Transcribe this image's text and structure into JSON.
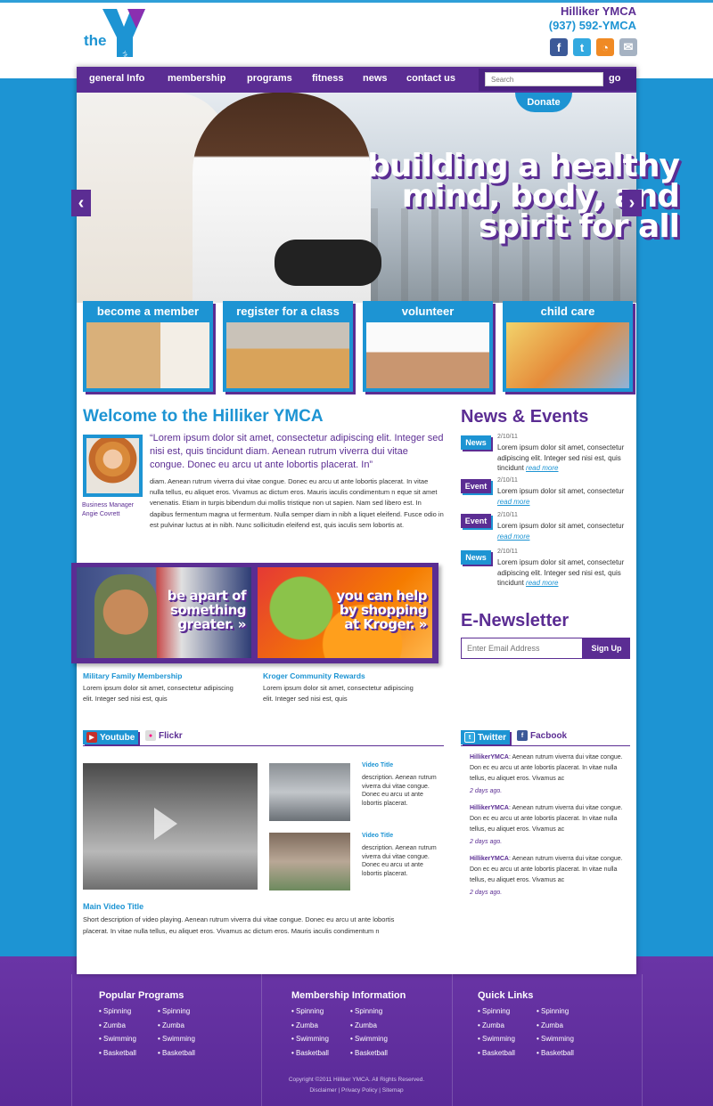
{
  "header": {
    "logo_the": "the",
    "logo_ymca": "YMCA",
    "org_name": "Hilliker YMCA",
    "phone": "(937) 592-YMCA",
    "social": [
      {
        "name": "facebook-icon",
        "glyph": "f",
        "color": "#3b5998"
      },
      {
        "name": "twitter-icon",
        "glyph": "t",
        "color": "#33a9e0"
      },
      {
        "name": "rss-icon",
        "glyph": "◔",
        "color": "#f08a24"
      },
      {
        "name": "email-icon",
        "glyph": "✉",
        "color": "#a5b2c2"
      }
    ]
  },
  "nav": {
    "items": [
      "general Info",
      "membership",
      "programs",
      "fitness",
      "news",
      "contact us"
    ],
    "search_placeholder": "Search",
    "go_label": "go"
  },
  "hero": {
    "headline_lines": [
      "building a healthy",
      "mind, body, and",
      "spirit for all"
    ],
    "donate_label": "Donate",
    "prev_glyph": "‹",
    "next_glyph": "›"
  },
  "features": [
    {
      "label": "become a member"
    },
    {
      "label": "register for a class"
    },
    {
      "label": "volunteer"
    },
    {
      "label": "child care"
    }
  ],
  "welcome": {
    "title": "Welcome to the Hilliker YMCA",
    "manager_title": "Business Manager",
    "manager_name": "Angie Covrett",
    "quote": "“Lorem ipsum dolor sit amet, consectetur adipiscing elit. Integer sed nisi est, quis  tincidunt diam. Aenean rutrum viverra dui vitae congue. Donec eu arcu ut ante lobortis placerat. In”",
    "body": "diam. Aenean rutrum viverra dui vitae congue. Donec eu arcu ut ante lobortis placerat. In vitae nulla tellus, eu aliquet eros. Vivamus ac dictum eros. Mauris iaculis condimentum n eque sit amet venenatis. Etiam in turpis bibendum dui  mollis tristique non ut sapien. Nam sed libero est. In dapibus fermentum magna ut fermentum. Nulla semper diam in nibh a liquet eleifend. Fusce odio in est pulvinar luctus at in nibh. Nunc sollicitudin eleifend est, quis iaculis sem lobortis at."
  },
  "promos": [
    {
      "banner_lines": [
        "be apart of",
        "something",
        "greater. »"
      ],
      "title": "Military Family Membership",
      "desc": "Lorem ipsum dolor sit amet, consectetur adipiscing elit. Integer sed nisi est, quis"
    },
    {
      "banner_lines": [
        "you can help",
        "by shopping",
        "at Kroger. »"
      ],
      "title": "Kroger Community Rewards",
      "desc": "Lorem ipsum dolor sit amet, consectetur adipiscing elit. Integer sed nisi est, quis"
    }
  ],
  "news": {
    "title": "News & Events",
    "items": [
      {
        "badge": "News",
        "date": "2/10/11",
        "text": "Lorem ipsum dolor sit amet, consectetur adipiscing elit. Integer sed nisi est, quis tincidunt",
        "more": "read more"
      },
      {
        "badge": "Event",
        "date": "2/10/11",
        "text": "Lorem ipsum dolor sit amet, consectetur",
        "more": "read more"
      },
      {
        "badge": "Event",
        "date": "2/10/11",
        "text": "Lorem ipsum dolor sit amet, consectetur",
        "more": "read more"
      },
      {
        "badge": "News",
        "date": "2/10/11",
        "text": "Lorem ipsum dolor sit amet, consectetur adipiscing elit. Integer sed nisi est, quis tincidunt",
        "more": "read more"
      }
    ]
  },
  "newsletter": {
    "title": "E-Newsletter",
    "placeholder": "Enter Email Address",
    "button": "Sign Up"
  },
  "media": {
    "tab_youtube": "Youtube",
    "tab_flickr": "Flickr",
    "videos": [
      {
        "title": "Video Title",
        "desc": "description. Aenean rutrum viverra dui vitae congue. Donec eu arcu ut ante lobortis placerat."
      },
      {
        "title": "Video Title",
        "desc": "description. Aenean rutrum viverra dui vitae congue. Donec eu arcu ut ante lobortis placerat."
      }
    ],
    "main_title": "Main Video Title",
    "main_desc": "Short description of video playing. Aenean rutrum viverra dui vitae congue. Donec eu arcu ut ante lobortis placerat. In vitae nulla tellus, eu aliquet eros. Vivamus ac dictum eros. Mauris iaculis condimentum n"
  },
  "social_feed": {
    "tab_twitter": "Twitter",
    "tab_facebook": "Facbook",
    "tweets": [
      {
        "user": "HillikerYMCA",
        "text": ": Aenean rutrum viverra dui vitae congue. Don ec eu arcu ut ante lobortis placerat. In vitae nulla tellus, eu aliquet eros. Vivamus ac",
        "time": "2 days ago."
      },
      {
        "user": "HillikerYMCA",
        "text": ": Aenean rutrum viverra dui vitae congue. Don ec eu arcu ut ante lobortis placerat. In vitae nulla tellus, eu aliquet eros. Vivamus ac",
        "time": "2 days ago."
      },
      {
        "user": "HillikerYMCA",
        "text": ": Aenean rutrum viverra dui vitae congue. Don ec eu arcu ut ante lobortis placerat. In vitae nulla tellus, eu aliquet eros. Vivamus ac",
        "time": "2 days ago."
      }
    ]
  },
  "footer": {
    "columns": [
      {
        "title": "Popular Programs",
        "items": [
          "Spinning",
          "Spinning",
          "Zumba",
          "Zumba",
          "Swimming",
          "Swimming",
          "Basketball",
          "Basketball"
        ]
      },
      {
        "title": "Membership Information",
        "items": [
          "Spinning",
          "Spinning",
          "Zumba",
          "Zumba",
          "Swimming",
          "Swimming",
          "Basketball",
          "Basketball"
        ]
      },
      {
        "title": "Quick Links",
        "items": [
          "Spinning",
          "Spinning",
          "Zumba",
          "Zumba",
          "Swimming",
          "Swimming",
          "Basketball",
          "Basketball"
        ]
      }
    ],
    "copyright": "Copyright ©2011 Hilliker YMCA. All Rights Reserved.",
    "links": [
      "Disclaimer",
      "Privacy Policy",
      "Sitemap"
    ]
  },
  "colors": {
    "purple": "#5b2d93",
    "blue": "#1d94d3"
  }
}
